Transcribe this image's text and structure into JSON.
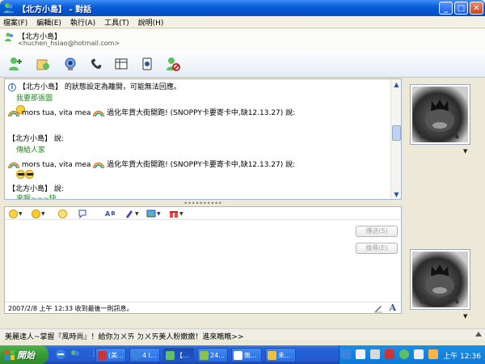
{
  "window": {
    "title": "【北方小島】 - 對話",
    "controls": {
      "minimize": "_",
      "maximize": "□",
      "close": "✕"
    }
  },
  "menu": [
    "檔案(F)",
    "編輯(E)",
    "執行(A)",
    "工具(T)",
    "說明(H)"
  ],
  "contact": {
    "name": "【北方小島】",
    "email": "<huchen_hsiao@hotmail.com>"
  },
  "toolbar": {
    "icons": [
      "invite-contact-icon",
      "send-files-icon",
      "webcam-icon",
      "call-icon",
      "activities-icon",
      "games-icon",
      "block-icon"
    ]
  },
  "conversation": {
    "status_notice": "【北方小島】 的狀態設定為離開，可能無法回應。",
    "lines": [
      {
        "kind": "text-green",
        "text": "我要那張圖"
      },
      {
        "kind": "emoticon",
        "text": ""
      },
      {
        "kind": "header-self",
        "name": "mors tua, vita mea",
        "message": "過化年貨大街開跑! (SNOPPY卡要寄卡中,缺12.13.27) 說:"
      },
      {
        "kind": "header",
        "text": "【北方小島】 說:"
      },
      {
        "kind": "text-green",
        "text": "傳給人家"
      },
      {
        "kind": "header-self",
        "name": "mors tua, vita mea",
        "message": "過化年貨大街開跑! (SNOPPY卡要寄卡中,缺12.13.27) 說:"
      },
      {
        "kind": "emoticon-cool",
        "text": ""
      },
      {
        "kind": "header",
        "text": "【北方小島】 說:"
      },
      {
        "kind": "text-green",
        "text": "來喔~~~快"
      }
    ],
    "splitter": "••••••••••"
  },
  "input": {
    "send_label": "傳送(S)",
    "search_label": "搜尋(E)",
    "last_message": "2007/2/8 上午 12:33 收到最後一則訊息。",
    "font_button": "A"
  },
  "ad": {
    "text": "美麗達人~掌握『風時尚』！給你ㄉㄨㄞ ㄉㄨㄞ美人粉嫩嫩！進來瞧瞧>>"
  },
  "taskbar": {
    "start_label": "開始",
    "tasks": [
      {
        "label": "(美..."
      },
      {
        "label": "4 I..."
      },
      {
        "label": "【..."
      },
      {
        "label": "24..."
      },
      {
        "label": "無..."
      },
      {
        "label": "未..."
      }
    ],
    "clock": "上午 12:36"
  },
  "colors": {
    "accent": "#0a5fd8",
    "message_green": "#228b22",
    "start_green": "#399b34"
  }
}
